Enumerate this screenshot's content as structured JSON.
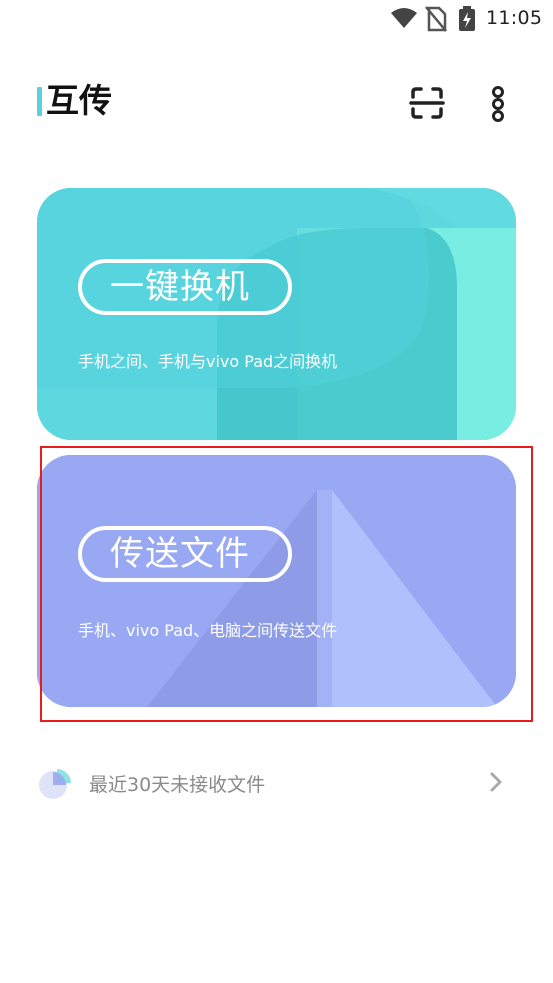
{
  "status_bar": {
    "time": "11:05",
    "icons": [
      "wifi-icon",
      "no-sim-icon",
      "battery-charging-icon"
    ]
  },
  "header": {
    "title": "互传",
    "actions": [
      "scan-icon",
      "more-vertical-icon"
    ]
  },
  "cards": {
    "switch": {
      "label": "一键换机",
      "subtitle": "手机之间、手机与vivo Pad之间换机",
      "color": "#5ed8df"
    },
    "transfer": {
      "label": "传送文件",
      "subtitle": "手机、vivo Pad、电脑之间传送文件",
      "color": "#99a8f3"
    }
  },
  "recent": {
    "label": "最近30天未接收文件",
    "icon": "pie-icon",
    "chevron": "chevron-right-icon"
  },
  "colors": {
    "accent": "#5ad1dc",
    "highlight": "#e81c1c"
  }
}
